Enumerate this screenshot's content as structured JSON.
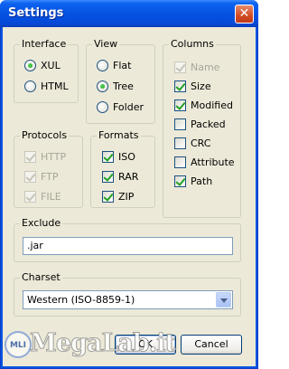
{
  "window": {
    "title": "Settings",
    "close_glyph": "✕"
  },
  "interface": {
    "legend": "Interface",
    "options": [
      {
        "label": "XUL",
        "selected": true
      },
      {
        "label": "HTML",
        "selected": false
      }
    ]
  },
  "view": {
    "legend": "View",
    "options": [
      {
        "label": "Flat",
        "selected": false
      },
      {
        "label": "Tree",
        "selected": true
      },
      {
        "label": "Folder",
        "selected": false
      }
    ]
  },
  "columns": {
    "legend": "Columns",
    "items": [
      {
        "label": "Name",
        "checked": true,
        "disabled": true
      },
      {
        "label": "Size",
        "checked": true,
        "disabled": false
      },
      {
        "label": "Modified",
        "checked": true,
        "disabled": false
      },
      {
        "label": "Packed",
        "checked": false,
        "disabled": false
      },
      {
        "label": "CRC",
        "checked": false,
        "disabled": false
      },
      {
        "label": "Attribute",
        "checked": false,
        "disabled": false
      },
      {
        "label": "Path",
        "checked": true,
        "disabled": false
      }
    ]
  },
  "protocols": {
    "legend": "Protocols",
    "items": [
      {
        "label": "HTTP",
        "checked": true,
        "disabled": true
      },
      {
        "label": "FTP",
        "checked": true,
        "disabled": true
      },
      {
        "label": "FILE",
        "checked": true,
        "disabled": true
      }
    ]
  },
  "formats": {
    "legend": "Formats",
    "items": [
      {
        "label": "ISO",
        "checked": true
      },
      {
        "label": "RAR",
        "checked": true
      },
      {
        "label": "ZIP",
        "checked": true
      }
    ]
  },
  "exclude": {
    "legend": "Exclude",
    "value": ".jar"
  },
  "charset": {
    "legend": "Charset",
    "value": "Western (ISO-8859-1)"
  },
  "buttons": {
    "ok": "OK",
    "cancel": "Cancel"
  },
  "watermark": {
    "text": "MegaLab.it",
    "logo": "MLI"
  }
}
